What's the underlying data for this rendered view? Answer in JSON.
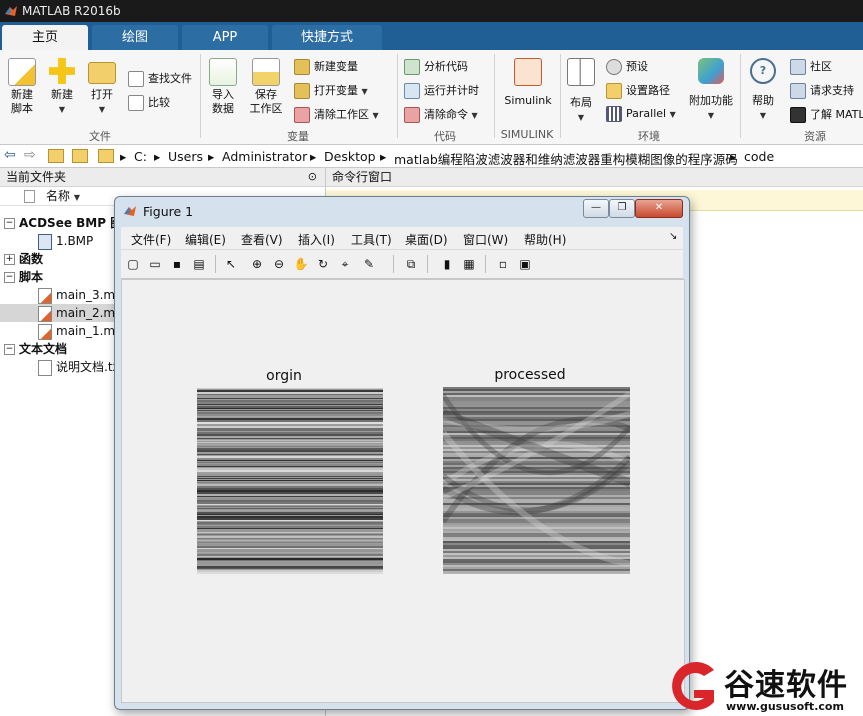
{
  "window": {
    "title": "MATLAB R2016b"
  },
  "tabs": [
    {
      "label": "主页",
      "active": true
    },
    {
      "label": "绘图",
      "active": false
    },
    {
      "label": "APP",
      "active": false
    },
    {
      "label": "快捷方式",
      "active": false
    }
  ],
  "ribbon": {
    "file": {
      "new_script": "新建\n脚本",
      "new": "新建",
      "open": "打开",
      "find_files": "查找文件",
      "compare": "比较",
      "group": "文件"
    },
    "variable": {
      "import": "导入\n数据",
      "save_ws": "保存\n工作区",
      "new_var": "新建变量",
      "open_var": "打开变量",
      "clear_ws": "清除工作区",
      "group": "变量"
    },
    "code": {
      "analyze": "分析代码",
      "run_time": "运行并计时",
      "clear_cmd": "清除命令",
      "group": "代码"
    },
    "simulink": {
      "label": "Simulink",
      "group": "SIMULINK"
    },
    "env": {
      "layout": "布局",
      "prefs": "预设",
      "set_path": "设置路径",
      "parallel": "Parallel",
      "addons": "附加功能",
      "group": "环境"
    },
    "resources": {
      "help": "帮助",
      "community": "社区",
      "support": "请求支持",
      "learn": "了解 MATL",
      "group": "资源"
    }
  },
  "address": {
    "segments": [
      "C:",
      "Users",
      "Administrator",
      "Desktop",
      "matlab编程陷波滤波器和维纳滤波器重构模糊图像的程序源码",
      "code"
    ]
  },
  "current_folder": {
    "title": "当前文件夹",
    "column": "名称",
    "tree": [
      {
        "label": "ACDSee BMP 图",
        "type": "group",
        "expanded": true
      },
      {
        "label": "1.BMP",
        "type": "bmp"
      },
      {
        "label": "函数",
        "type": "group",
        "expanded": false
      },
      {
        "label": "脚本",
        "type": "group",
        "expanded": true
      },
      {
        "label": "main_3.m",
        "type": "m"
      },
      {
        "label": "main_2.m",
        "type": "m",
        "selected": true
      },
      {
        "label": "main_1.m",
        "type": "m"
      },
      {
        "label": "文本文档",
        "type": "group",
        "expanded": true
      },
      {
        "label": "说明文档.txt",
        "type": "txt"
      }
    ]
  },
  "command_window": {
    "title": "命令行窗口"
  },
  "figure": {
    "title": "Figure 1",
    "menus": [
      "文件(F)",
      "编辑(E)",
      "查看(V)",
      "插入(I)",
      "工具(T)",
      "桌面(D)",
      "窗口(W)",
      "帮助(H)"
    ],
    "toolbar_icons": [
      "new-figure-icon",
      "open-icon",
      "save-icon",
      "print-icon",
      "pointer-icon",
      "zoom-in-icon",
      "zoom-out-icon",
      "pan-icon",
      "rotate-icon",
      "data-cursor-icon",
      "brush-icon",
      "link-icon",
      "colorbar-icon",
      "legend-icon",
      "hide-plot-tools-icon",
      "show-plot-tools-icon"
    ],
    "plots": [
      {
        "title": "orgin"
      },
      {
        "title": "processed"
      }
    ]
  },
  "watermark": {
    "brand": "谷速软件",
    "url": "www.gususoft.com"
  },
  "colors": {
    "accent_blue": "#1f5f96",
    "title_bar": "#1a1a1a",
    "figure_frame": "#d5e1ec",
    "watermark_red": "#d9262b"
  }
}
